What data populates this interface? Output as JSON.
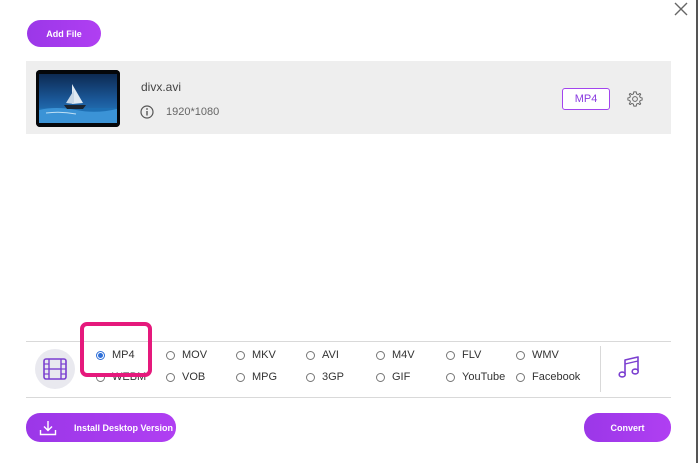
{
  "toolbar": {
    "add_file_label": "Add File"
  },
  "file": {
    "name": "divx.avi",
    "resolution": "1920*1080",
    "format_badge": "MP4",
    "thumbnail_icon": "sailboat-thumbnail"
  },
  "formats": [
    {
      "label": "MP4",
      "selected": true
    },
    {
      "label": "MOV",
      "selected": false
    },
    {
      "label": "MKV",
      "selected": false
    },
    {
      "label": "AVI",
      "selected": false
    },
    {
      "label": "M4V",
      "selected": false
    },
    {
      "label": "FLV",
      "selected": false
    },
    {
      "label": "WMV",
      "selected": false
    },
    {
      "label": "WEBM",
      "selected": false
    },
    {
      "label": "VOB",
      "selected": false
    },
    {
      "label": "MPG",
      "selected": false
    },
    {
      "label": "3GP",
      "selected": false
    },
    {
      "label": "GIF",
      "selected": false
    },
    {
      "label": "YouTube",
      "selected": false
    },
    {
      "label": "Facebook",
      "selected": false
    }
  ],
  "footer": {
    "install_label": "Install Desktop Version",
    "convert_label": "Convert"
  },
  "icons": {
    "close": "close-icon",
    "info": "info-icon",
    "settings": "gear-icon",
    "video_tab": "film-icon",
    "audio_tab": "music-note-icon",
    "download": "download-icon"
  },
  "colors": {
    "accent": "#a43bee",
    "highlight": "#e5197c",
    "radio_selected": "#2e6fd8"
  }
}
